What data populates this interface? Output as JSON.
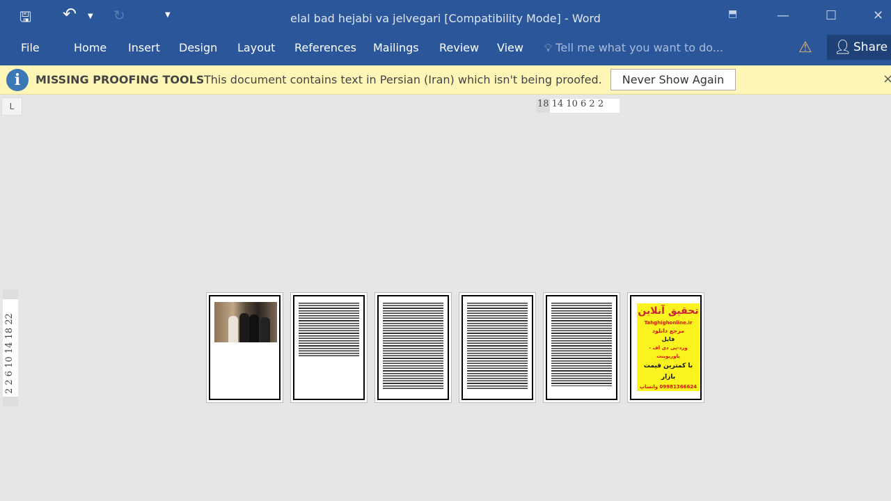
{
  "window": {
    "title": "elal bad hejabi va jelvegari [Compatibility Mode] - Word"
  },
  "quick_access": {
    "save": "save-icon",
    "undo": "undo-icon",
    "redo": "redo-icon",
    "customize": "customize-icon"
  },
  "ribbon": {
    "tabs": [
      "File",
      "Home",
      "Insert",
      "Design",
      "Layout",
      "References",
      "Mailings",
      "Review",
      "View"
    ],
    "tell_me": "Tell me what you want to do...",
    "share": "Share"
  },
  "message_bar": {
    "title": "MISSING PROOFING TOOLS",
    "text": "This document contains text in Persian (Iran) which isn't being proofed.",
    "button": "Never Show Again",
    "close": "×"
  },
  "rulers": {
    "horizontal": "18 14 10 6 2 2",
    "vertical": "2 2 6 10 14 18 22",
    "tab_selector": "L"
  },
  "colors": {
    "ribbon": "#2b579a",
    "message_bar": "#fdf6b7",
    "workspace": "#e6e6e6"
  },
  "pages": {
    "count": 6,
    "poster": [
      "تحقیق آنلاین",
      "Tahghighonline.ir",
      "مرجع دانلود",
      "فایل",
      "ورد-پی دی اف - پاورپوینت",
      "با کمترین قیمت بازار",
      "09981366624 واتساپ"
    ]
  }
}
